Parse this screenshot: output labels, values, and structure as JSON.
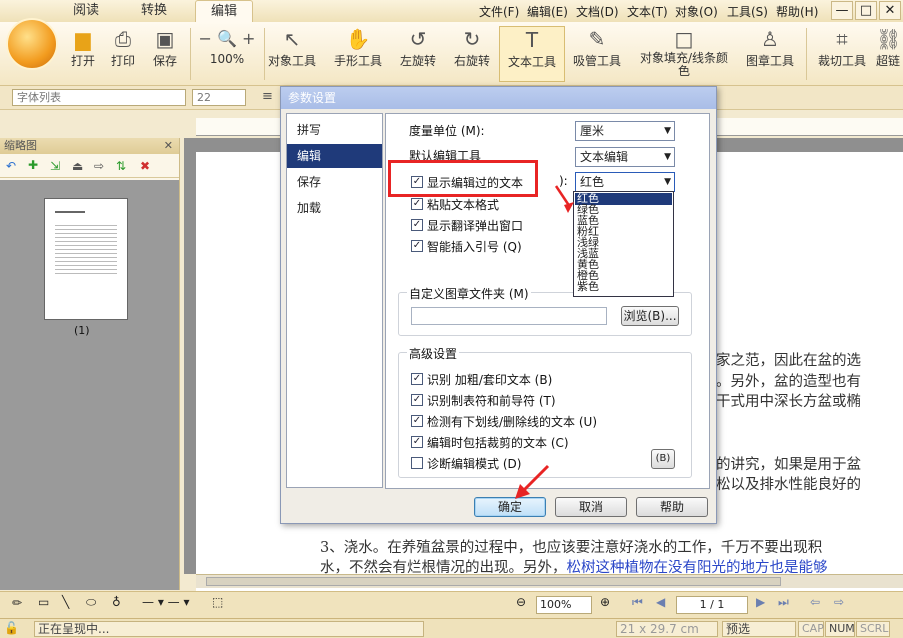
{
  "tabs": [
    {
      "label": "阅读",
      "active": false
    },
    {
      "label": "转换",
      "active": false
    },
    {
      "label": "编辑",
      "active": true
    }
  ],
  "menu": [
    "文件(F)",
    "编辑(E)",
    "文档(D)",
    "文本(T)",
    "对象(O)",
    "工具(S)",
    "帮助(H)"
  ],
  "window_buttons": [
    "—",
    "□",
    "✕"
  ],
  "ribbon": [
    {
      "label": "打开",
      "icon": "folder-icon"
    },
    {
      "label": "打印",
      "icon": "printer-icon"
    },
    {
      "label": "保存",
      "icon": "save-icon"
    },
    {
      "label": "100%",
      "icon": "zoom-icon"
    },
    {
      "label": "对象工具",
      "icon": "arrow-icon"
    },
    {
      "label": "手形工具",
      "icon": "hand-icon"
    },
    {
      "label": "左旋转",
      "icon": "rotate-left-icon"
    },
    {
      "label": "右旋转",
      "icon": "rotate-right-icon"
    },
    {
      "label": "文本工具",
      "icon": "text-tool-icon",
      "selected": true
    },
    {
      "label": "吸管工具",
      "icon": "eyedropper-icon"
    },
    {
      "label": "对象填充/线条颜色",
      "icon": "fill-color-icon"
    },
    {
      "label": "图章工具",
      "icon": "stamp-icon"
    },
    {
      "label": "裁切工具",
      "icon": "crop-icon"
    },
    {
      "label": "超链",
      "icon": "link-icon"
    }
  ],
  "fontbar": {
    "font_list": "字体列表",
    "font_size": "22"
  },
  "left_panel": {
    "title": "缩略图",
    "page_label": "(1)"
  },
  "document": {
    "lines": [
      {
        "text": "家之范，因此在盆的选",
        "blue": false
      },
      {
        "text": "。另外，盆的造型也有",
        "blue": false
      },
      {
        "text": "干式用中深长方盆或椭",
        "blue": false
      },
      {
        "text": "的讲究，如果是用于盆",
        "blue": false
      },
      {
        "text": "松以及排水性能良好的",
        "blue": false
      },
      {
        "text": "3、浇水。在养殖盆景的过程中，也应该要注意好浇水的工作，千万不要出现积",
        "blue": false
      }
    ],
    "last_line_black": "水，不然会有烂根情况的出现。另外，",
    "last_line_blue": "松树这种植物在没有阳光的地方也是能够"
  },
  "dialog": {
    "title": "参数设置",
    "nav": [
      {
        "label": "拼写",
        "selected": false
      },
      {
        "label": "编辑",
        "selected": true
      },
      {
        "label": "保存",
        "selected": false
      },
      {
        "label": "加载",
        "selected": false
      }
    ],
    "measure_unit_label": "度量单位 (M):",
    "measure_unit_value": "厘米",
    "default_tool_label": "默认编辑工具",
    "default_tool_value": "文本编辑",
    "show_edited_label": "显示编辑过的文本",
    "show_edited_suffix": "):",
    "show_edited_color": "红色",
    "checks_top": [
      {
        "label": "显示编辑过的文本",
        "checked": true
      },
      {
        "label": "粘贴文本格式",
        "checked": true
      },
      {
        "label": "显示翻译弹出窗口",
        "checked": true
      },
      {
        "label": "智能插入引号 (Q)",
        "checked": true
      }
    ],
    "color_options": [
      "红色",
      "绿色",
      "蓝色",
      "粉红",
      "浅绿",
      "浅蓝",
      "黄色",
      "橙色",
      "紫色"
    ],
    "stamp_folder_group": "自定义图章文件夹 (M)",
    "browse_button": "浏览(B)...",
    "advanced_group": "高级设置",
    "advanced_checks": [
      {
        "label": "识别 加粗/套印文本 (B)",
        "checked": true
      },
      {
        "label": "识别制表符和前导符 (T)",
        "checked": true
      },
      {
        "label": "检测有下划线/删除线的文本 (U)",
        "checked": true
      },
      {
        "label": "编辑时包括裁剪的文本 (C)",
        "checked": true
      },
      {
        "label": "诊断编辑模式 (D)",
        "checked": false
      }
    ],
    "side_btn": "(B)",
    "ok": "确定",
    "cancel": "取消",
    "help": "帮助"
  },
  "bottom": {
    "zoom": "100%",
    "page": "1 / 1",
    "status": "正在呈现中...",
    "page_size": "21 x 29.7 cm",
    "preview": "预选",
    "cap": "CAP",
    "num": "NUM",
    "scrl": "SCRL"
  },
  "colors": {
    "accent_red": "#e82424",
    "selection": "#1f3a7a",
    "link_blue": "#2b47c8"
  }
}
